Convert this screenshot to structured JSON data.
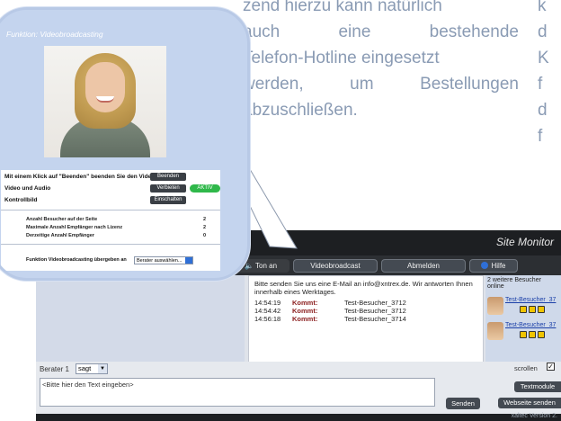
{
  "article": {
    "mid_lines": [
      "zend hierzu kann natürlich",
      "auch",
      "eine",
      "bestehende",
      "Telefon-Hotline eingesetzt",
      "werden,",
      "um",
      "Bestellungen",
      "abzuschließen."
    ],
    "right_lines": [
      "k",
      "d",
      "K",
      "f",
      "d",
      "f"
    ]
  },
  "app": {
    "title": "Site Monitor",
    "toolbar": {
      "ton": "Ton an",
      "video": "Videobroadcast",
      "abmelden": "Abmelden",
      "hilfe": "Hilfe"
    },
    "chat": {
      "intro": "Bitte senden Sie uns eine E-Mail an info@xntrex.de. Wir antworten Ihnen innerhalb eines Werktages.",
      "rows": [
        {
          "time": "14:54:19",
          "status": "Kommt:",
          "visitor": "Test-Besucher_3712"
        },
        {
          "time": "14:54:42",
          "status": "Kommt:",
          "visitor": "Test-Besucher_3712"
        },
        {
          "time": "14:56:18",
          "status": "Kommt:",
          "visitor": "Test-Besucher_3714"
        }
      ]
    },
    "visitors": {
      "header": "2 weitere Besucher online",
      "items": [
        "Test-Besucher_37",
        "Test-Besucher_37"
      ]
    },
    "bottom": {
      "advisor_label": "Berater 1",
      "verb": "sagt",
      "input_placeholder": "<Bitte hier den Text eingeben>",
      "send": "Senden",
      "scroll_label": "scrollen",
      "textmodule": "Textmodule",
      "website_send": "Webseite senden"
    },
    "version": "xaltec Version 2."
  },
  "bubble": {
    "title": "Funktion: Videobroadcasting",
    "row1_label": "Mit einem Klick auf \"Beenden\" beenden Sie den Videobroadcast",
    "row1_button": "Beenden",
    "row2_label": "Video und Audio",
    "row2_button": "Verbieten",
    "aktiv": "AKTIV",
    "row3_label": "Kontrollbild",
    "row3_button": "Einschalten",
    "stats": [
      {
        "label": "Anzahl Besucher auf der Seite",
        "value": "2"
      },
      {
        "label": "Maximale Anzahl Empfänger nach Lizenz",
        "value": "2"
      },
      {
        "label": "Derzeitige Anzahl Empfänger",
        "value": "0"
      }
    ],
    "transfer_label": "Funktion Videobroadcasting übergeben an",
    "transfer_select": "Berater auswählen..."
  }
}
